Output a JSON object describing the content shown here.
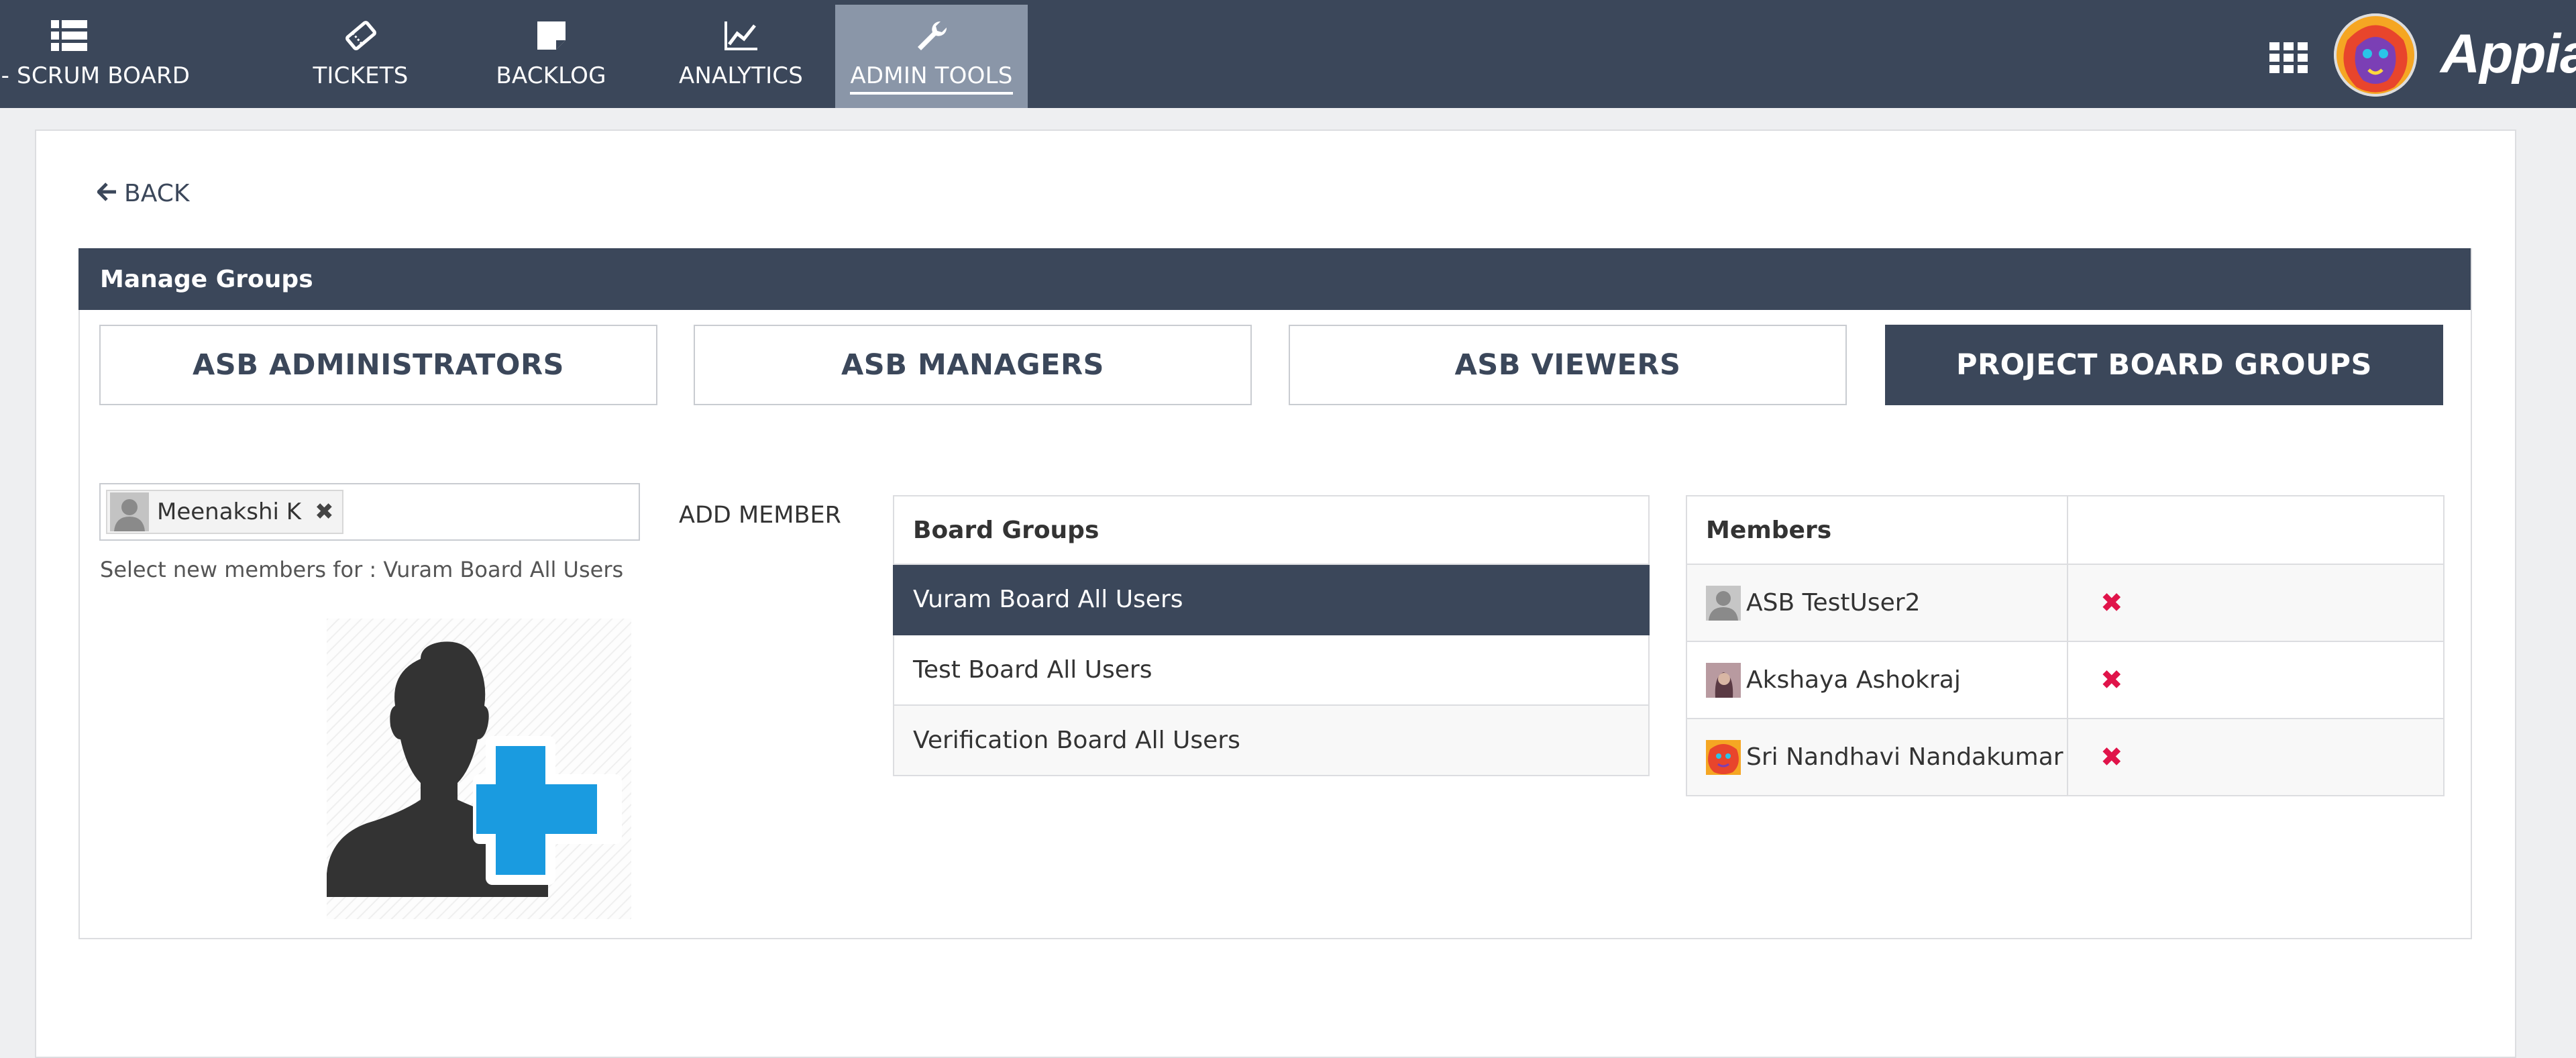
{
  "nav": {
    "items": [
      {
        "label": "ASB - SCRUM BOARD",
        "icon": "list-icon"
      },
      {
        "label": "TICKETS",
        "icon": "ticket-icon"
      },
      {
        "label": "BACKLOG",
        "icon": "note-icon"
      },
      {
        "label": "ANALYTICS",
        "icon": "chart-icon"
      },
      {
        "label": "ADMIN TOOLS",
        "icon": "wrench-icon",
        "active": true
      }
    ],
    "brand": "Appian"
  },
  "back_label": "BACK",
  "panel_title": "Manage Groups",
  "tabs": [
    {
      "label": "ASB ADMINISTRATORS"
    },
    {
      "label": "ASB MANAGERS"
    },
    {
      "label": "ASB VIEWERS"
    },
    {
      "label": "PROJECT BOARD GROUPS",
      "active": true
    }
  ],
  "picker": {
    "token_label": "Meenakshi K",
    "helper_text": "Select new members for : Vuram Board All Users"
  },
  "add_member_label": "ADD MEMBER",
  "board_groups": {
    "header": "Board Groups",
    "rows": [
      "Vuram Board All Users",
      "Test Board All Users",
      "Verification Board All Users"
    ],
    "selected_index": 0
  },
  "members": {
    "header": "Members",
    "rows": [
      "ASB TestUser2",
      "Akshaya Ashokraj",
      "Sri Nandhavi Nandakumar"
    ]
  },
  "colors": {
    "nav_bg": "#3b475a",
    "nav_active": "#8a96a8",
    "remove": "#e0144a",
    "add_plus": "#1a9be0"
  }
}
